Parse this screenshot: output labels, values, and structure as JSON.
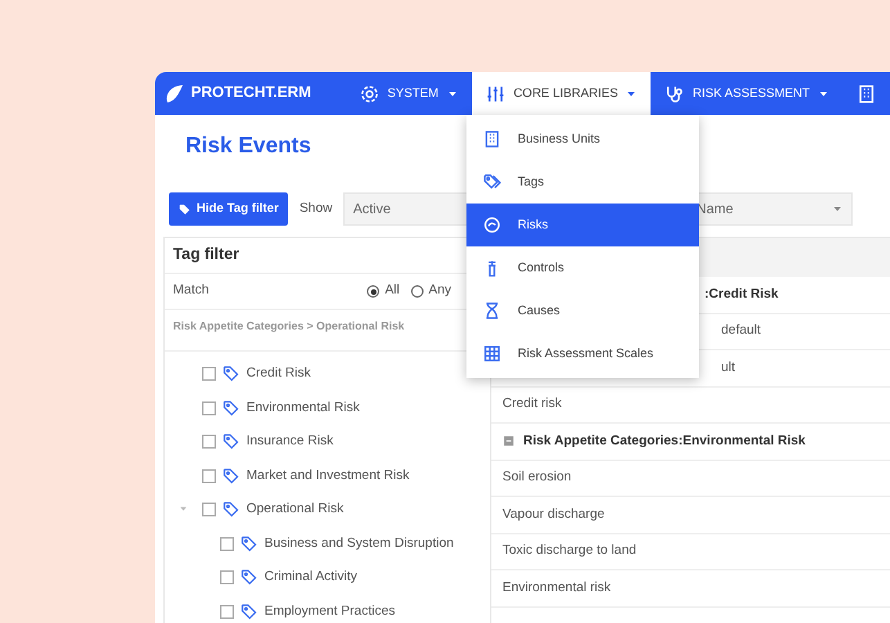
{
  "brand": "PROTECHT.ERM",
  "nav": [
    {
      "label": "SYSTEM",
      "selected": false
    },
    {
      "label": "CORE LIBRARIES",
      "selected": true
    },
    {
      "label": "RISK ASSESSMENT",
      "selected": false
    },
    {
      "selected": false
    }
  ],
  "menu": [
    {
      "label": "Business Units",
      "selected": false
    },
    {
      "label": "Tags",
      "selected": false
    },
    {
      "label": "Risks",
      "selected": true
    },
    {
      "label": "Controls",
      "selected": false
    },
    {
      "label": "Causes",
      "selected": false
    },
    {
      "label": "Risk Assessment Scales",
      "selected": false
    }
  ],
  "title": "Risk Events",
  "toolbar": {
    "button": "Hide Tag filter",
    "show_label": "Show",
    "show_value": "Active",
    "sort_value": "Name"
  },
  "tag_filter": {
    "title": "Tag filter",
    "match_label": "Match",
    "match": [
      {
        "label": "All",
        "selected": true
      },
      {
        "label": "Any",
        "selected": false
      }
    ],
    "breadcrumb": "Risk Appetite Categories > Operational Risk",
    "tree": [
      {
        "label": "Credit Risk",
        "checked": false
      },
      {
        "label": "Environmental Risk",
        "checked": false
      },
      {
        "label": "Insurance Risk",
        "checked": false
      },
      {
        "label": "Market and Investment Risk",
        "checked": false
      },
      {
        "label": "Operational Risk",
        "checked": false,
        "expanded": true,
        "children": [
          {
            "label": "Business and System Disruption",
            "checked": false
          },
          {
            "label": "Criminal Activity",
            "checked": false
          },
          {
            "label": "Employment Practices",
            "checked": false
          }
        ]
      }
    ]
  },
  "results": [
    {
      "kind": "group",
      "text": ":Credit Risk"
    },
    {
      "kind": "item",
      "text": "default"
    },
    {
      "kind": "item",
      "text": "ult"
    },
    {
      "kind": "item",
      "text": "Credit risk"
    },
    {
      "kind": "group",
      "text": "Risk Appetite Categories:Environmental Risk",
      "expanded": true
    },
    {
      "kind": "item",
      "text": "Soil erosion"
    },
    {
      "kind": "item",
      "text": "Vapour discharge"
    },
    {
      "kind": "item",
      "text": "Toxic discharge to land"
    },
    {
      "kind": "item",
      "text": "Environmental risk"
    }
  ]
}
